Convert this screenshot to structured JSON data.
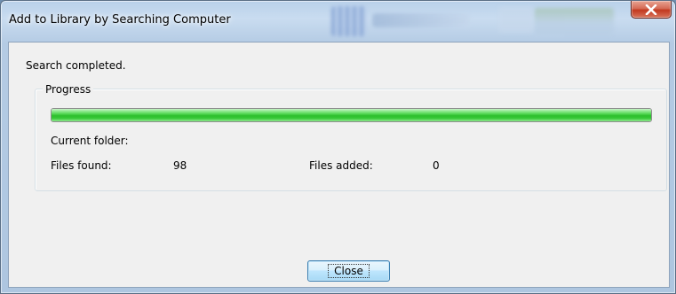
{
  "window": {
    "title": "Add to Library by Searching Computer"
  },
  "status": "Search completed.",
  "progress_group": {
    "label": "Progress",
    "progress_fraction": 1.0,
    "current_folder_label": "Current folder:",
    "current_folder_value": "",
    "files_found_label": "Files found:",
    "files_found_value": "98",
    "files_added_label": "Files added:",
    "files_added_value": "0"
  },
  "buttons": {
    "close_label": "Close"
  },
  "icons": {
    "title_close": "close-icon"
  },
  "colors": {
    "progress_green": "#2dbf2d",
    "close_button_red": "#c2391f"
  }
}
